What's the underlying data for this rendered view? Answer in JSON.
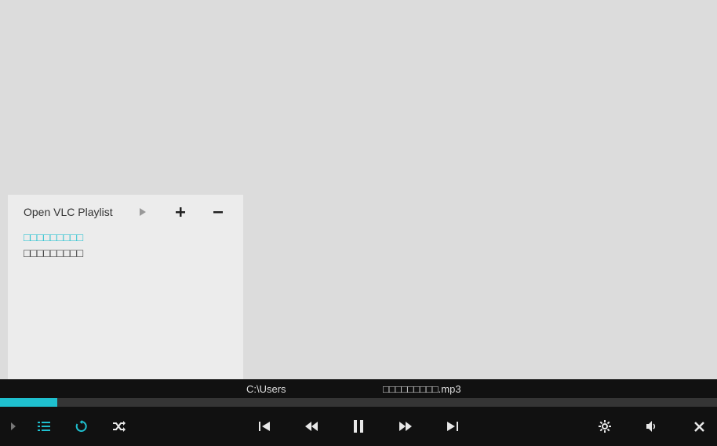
{
  "playlist": {
    "title_label": "Open VLC Playlist",
    "items": [
      {
        "label": "□□□□□□□□□",
        "active": true
      },
      {
        "label": "□□□□□□□□□",
        "active": false
      }
    ]
  },
  "nowplaying": {
    "path": "C:\\Users",
    "file": "□□□□□□□□□.mp3"
  },
  "progress": {
    "percent": 8
  },
  "icons": {
    "play_small": "play-small-icon",
    "plus": "plus-icon",
    "minus": "minus-icon",
    "playlist_open": "chevron-right-icon",
    "queue": "list-icon",
    "repeat": "repeat-icon",
    "shuffle": "shuffle-icon",
    "prev": "skip-start-icon",
    "rewind": "rewind-icon",
    "pause": "pause-icon",
    "forward": "fast-forward-icon",
    "next": "skip-end-icon",
    "settings": "gear-icon",
    "volume": "volume-icon",
    "close": "close-icon"
  },
  "colors": {
    "accent": "#1fc0cf",
    "background": "#dcdcdc",
    "panel": "#ececec",
    "bar_dark": "#111111",
    "track": "#353535"
  }
}
